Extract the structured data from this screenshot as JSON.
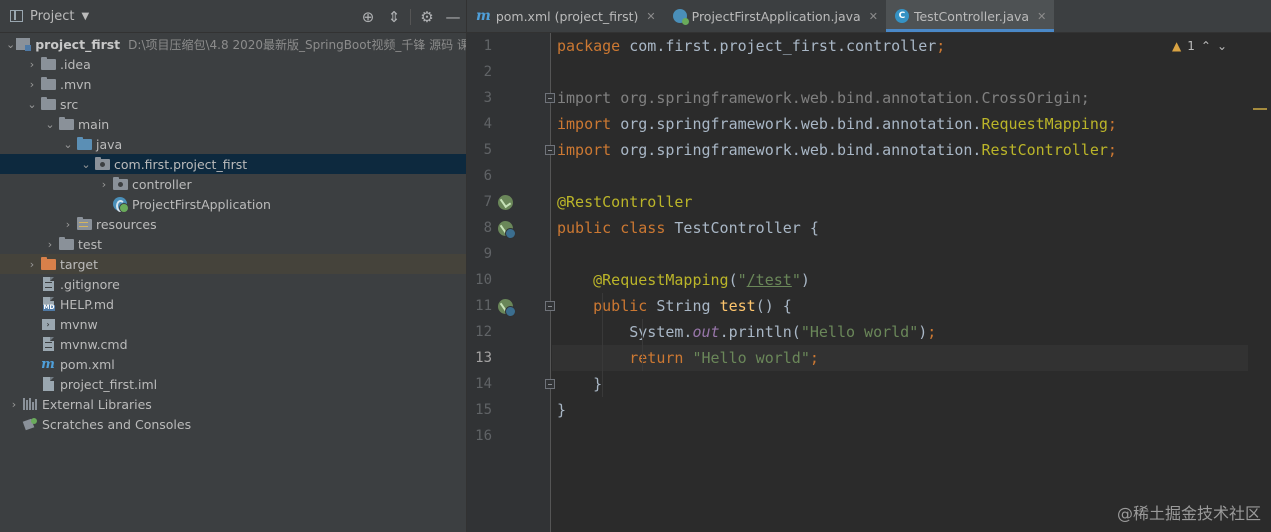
{
  "panel": {
    "title": "Project"
  },
  "tree": {
    "root_name": "project_first",
    "root_path": "D:\\项目压缩包\\4.8 2020最新版_SpringBoot视频_千锋 源码 课件",
    "items": {
      "idea": ".idea",
      "mvn": ".mvn",
      "src": "src",
      "main": "main",
      "java": "java",
      "package": "com.first.project_first",
      "controller": "controller",
      "app": "ProjectFirstApplication",
      "resources": "resources",
      "test": "test",
      "target": "target",
      "gitignore": ".gitignore",
      "help": "HELP.md",
      "mvnw": "mvnw",
      "mvnw_cmd": "mvnw.cmd",
      "pom": "pom.xml",
      "iml": "project_first.iml",
      "libs": "External Libraries",
      "scratches": "Scratches and Consoles"
    },
    "md_badge": "MD"
  },
  "tabs": [
    {
      "label": "pom.xml (project_first)",
      "icon": "maven-icon"
    },
    {
      "label": "ProjectFirstApplication.java",
      "icon": "spring-boot-icon"
    },
    {
      "label": "TestController.java",
      "icon": "java-class-icon",
      "active": true
    }
  ],
  "tab_icon_letters": {
    "m": "m",
    "class": "C"
  },
  "editor": {
    "line_numbers": [
      "1",
      "2",
      "3",
      "4",
      "5",
      "6",
      "7",
      "8",
      "9",
      "10",
      "11",
      "12",
      "13",
      "14",
      "15",
      "16"
    ],
    "current_line": 13,
    "code": {
      "l1_kw": "package",
      "l1_rest": " com.first.project_first.controller",
      "semi": ";",
      "l3": "import org.springframework.web.bind.annotation.CrossOrigin;",
      "import_kw": "import",
      "l4_pkg": " org.springframework.web.bind.annotation.",
      "l4_cls": "RequestMapping",
      "l5_cls": "RestController",
      "l7": "@RestController",
      "l8_kw": "public class",
      "l8_rest": " TestController {",
      "l10_ann": "@RequestMapping",
      "l10_open": "(",
      "l10_q1": "\"",
      "l10_path": "/test",
      "l10_q2": "\"",
      "l10_close": ")",
      "l11_kw": "public",
      "l11_type": " String ",
      "l11_fn": "test",
      "l11_rest": "() {",
      "l12_a": "System.",
      "l12_out": "out",
      "l12_b": ".println(",
      "l12_str": "\"Hello world\"",
      "l12_c": ")",
      "l13_kw": "return",
      "l13_str": "\"Hello world\"",
      "l14": "}",
      "l15": "}"
    },
    "inspection": {
      "warnings": "1"
    }
  },
  "watermark": "@稀土掘金技术社区",
  "colors": {
    "keyword": "#cc7832",
    "annotation": "#bbb529",
    "string": "#6a8759",
    "accent": "#4a88c7"
  }
}
